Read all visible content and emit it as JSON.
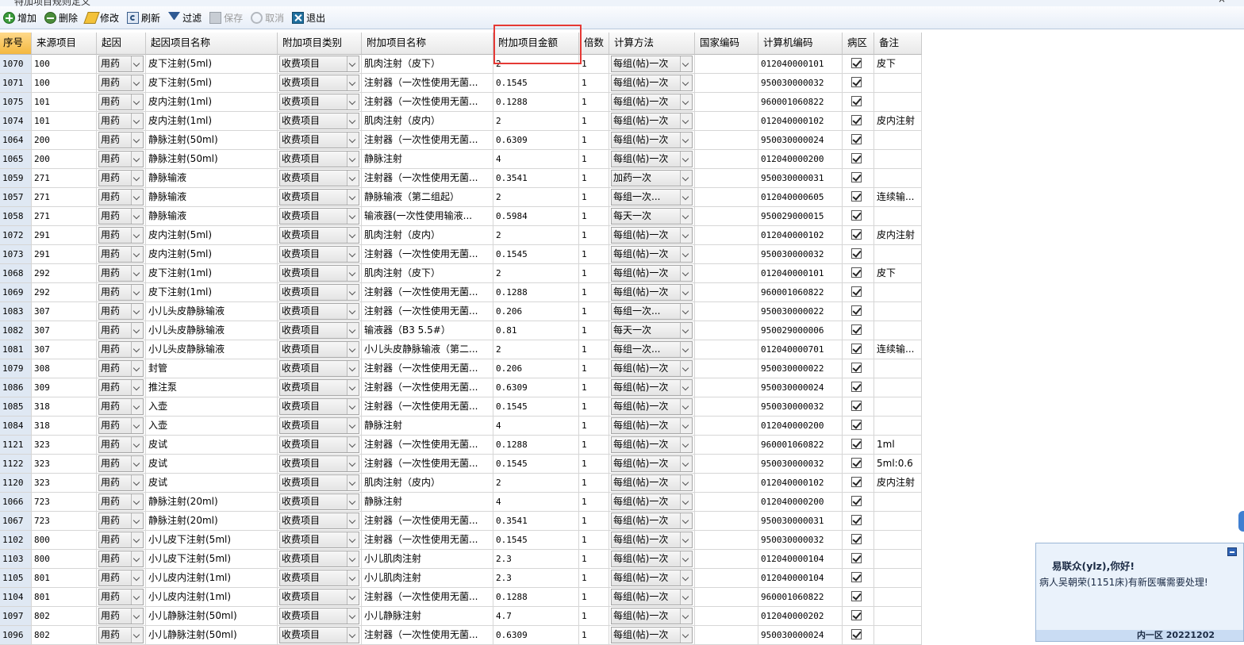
{
  "window": {
    "title": "特加项目规则定义",
    "minimize": "–",
    "close": "×"
  },
  "toolbar": [
    {
      "label": "增加",
      "icon": "add-icon",
      "enabled": true
    },
    {
      "label": "删除",
      "icon": "delete-icon",
      "enabled": true
    },
    {
      "label": "修改",
      "icon": "edit-icon",
      "enabled": true
    },
    {
      "label": "刷新",
      "icon": "refresh-icon",
      "enabled": true
    },
    {
      "label": "过滤",
      "icon": "filter-icon",
      "enabled": true
    },
    {
      "label": "保存",
      "icon": "save-icon",
      "enabled": false
    },
    {
      "label": "取消",
      "icon": "cancel-icon",
      "enabled": false
    },
    {
      "label": "退出",
      "icon": "exit-icon",
      "enabled": true
    }
  ],
  "columns": [
    "序号",
    "来源项目",
    "起因",
    "起因项目名称",
    "附加项目类别",
    "附加项目名称",
    "附加项目金额",
    "倍数",
    "计算方法",
    "国家编码",
    "计算机编码",
    "病区",
    "备注"
  ],
  "rows": [
    [
      "1070",
      "100",
      "用药",
      "皮下注射(5ml)",
      "收费项目",
      "肌肉注射（皮下）",
      "2",
      "1",
      "每组(帖)一次",
      "",
      "012040000101",
      true,
      "皮下"
    ],
    [
      "1071",
      "100",
      "用药",
      "皮下注射(5ml)",
      "收费项目",
      "注射器（一次性使用无菌...",
      "0.1545",
      "1",
      "每组(帖)一次",
      "",
      "950030000032",
      true,
      ""
    ],
    [
      "1075",
      "101",
      "用药",
      "皮内注射(1ml)",
      "收费项目",
      "注射器（一次性使用无菌...",
      "0.1288",
      "1",
      "每组(帖)一次",
      "",
      "960001060822",
      true,
      ""
    ],
    [
      "1074",
      "101",
      "用药",
      "皮内注射(1ml)",
      "收费项目",
      "肌肉注射（皮内）",
      "2",
      "1",
      "每组(帖)一次",
      "",
      "012040000102",
      true,
      "皮内注射"
    ],
    [
      "1064",
      "200",
      "用药",
      "静脉注射(50ml)",
      "收费项目",
      "注射器（一次性使用无菌...",
      "0.6309",
      "1",
      "每组(帖)一次",
      "",
      "950030000024",
      true,
      ""
    ],
    [
      "1065",
      "200",
      "用药",
      "静脉注射(50ml)",
      "收费项目",
      "静脉注射",
      "4",
      "1",
      "每组(帖)一次",
      "",
      "012040000200",
      true,
      ""
    ],
    [
      "1059",
      "271",
      "用药",
      "静脉输液",
      "收费项目",
      "注射器（一次性使用无菌...",
      "0.3541",
      "1",
      "加药一次",
      "",
      "950030000031",
      true,
      ""
    ],
    [
      "1057",
      "271",
      "用药",
      "静脉输液",
      "收费项目",
      "静脉输液（第二组起）",
      "2",
      "1",
      "每组一次...",
      "",
      "012040000605",
      true,
      "连续输..."
    ],
    [
      "1058",
      "271",
      "用药",
      "静脉输液",
      "收费项目",
      "输液器(一次性使用输液...",
      "0.5984",
      "1",
      "每天一次",
      "",
      "950029000015",
      true,
      ""
    ],
    [
      "1072",
      "291",
      "用药",
      "皮内注射(5ml)",
      "收费项目",
      "肌肉注射（皮内）",
      "2",
      "1",
      "每组(帖)一次",
      "",
      "012040000102",
      true,
      "皮内注射"
    ],
    [
      "1073",
      "291",
      "用药",
      "皮内注射(5ml)",
      "收费项目",
      "注射器（一次性使用无菌...",
      "0.1545",
      "1",
      "每组(帖)一次",
      "",
      "950030000032",
      true,
      ""
    ],
    [
      "1068",
      "292",
      "用药",
      "皮下注射(1ml)",
      "收费项目",
      "肌肉注射（皮下）",
      "2",
      "1",
      "每组(帖)一次",
      "",
      "012040000101",
      true,
      "皮下"
    ],
    [
      "1069",
      "292",
      "用药",
      "皮下注射(1ml)",
      "收费项目",
      "注射器（一次性使用无菌...",
      "0.1288",
      "1",
      "每组(帖)一次",
      "",
      "960001060822",
      true,
      ""
    ],
    [
      "1083",
      "307",
      "用药",
      "小儿头皮静脉输液",
      "收费项目",
      "注射器（一次性使用无菌...",
      "0.206",
      "1",
      "每组一次...",
      "",
      "950030000022",
      true,
      ""
    ],
    [
      "1082",
      "307",
      "用药",
      "小儿头皮静脉输液",
      "收费项目",
      "输液器（B3 5.5#）",
      "0.81",
      "1",
      "每天一次",
      "",
      "950029000006",
      true,
      ""
    ],
    [
      "1081",
      "307",
      "用药",
      "小儿头皮静脉输液",
      "收费项目",
      "小儿头皮静脉输液（第二...",
      "2",
      "1",
      "每组一次...",
      "",
      "012040000701",
      true,
      "连续输..."
    ],
    [
      "1079",
      "308",
      "用药",
      "封管",
      "收费项目",
      "注射器（一次性使用无菌...",
      "0.206",
      "1",
      "每组(帖)一次",
      "",
      "950030000022",
      true,
      ""
    ],
    [
      "1086",
      "309",
      "用药",
      "推注泵",
      "收费项目",
      "注射器（一次性使用无菌...",
      "0.6309",
      "1",
      "每组(帖)一次",
      "",
      "950030000024",
      true,
      ""
    ],
    [
      "1085",
      "318",
      "用药",
      "入壶",
      "收费项目",
      "注射器（一次性使用无菌...",
      "0.1545",
      "1",
      "每组(帖)一次",
      "",
      "950030000032",
      true,
      ""
    ],
    [
      "1084",
      "318",
      "用药",
      "入壶",
      "收费项目",
      "静脉注射",
      "4",
      "1",
      "每组(帖)一次",
      "",
      "012040000200",
      true,
      ""
    ],
    [
      "1121",
      "323",
      "用药",
      "皮试",
      "收费项目",
      "注射器（一次性使用无菌...",
      "0.1288",
      "1",
      "每组(帖)一次",
      "",
      "960001060822",
      true,
      "1ml"
    ],
    [
      "1122",
      "323",
      "用药",
      "皮试",
      "收费项目",
      "注射器（一次性使用无菌...",
      "0.1545",
      "1",
      "每组(帖)一次",
      "",
      "950030000032",
      true,
      "5ml:0.6"
    ],
    [
      "1120",
      "323",
      "用药",
      "皮试",
      "收费项目",
      "肌肉注射（皮内）",
      "2",
      "1",
      "每组(帖)一次",
      "",
      "012040000102",
      true,
      "皮内注射"
    ],
    [
      "1066",
      "723",
      "用药",
      "静脉注射(20ml)",
      "收费项目",
      "静脉注射",
      "4",
      "1",
      "每组(帖)一次",
      "",
      "012040000200",
      true,
      ""
    ],
    [
      "1067",
      "723",
      "用药",
      "静脉注射(20ml)",
      "收费项目",
      "注射器（一次性使用无菌...",
      "0.3541",
      "1",
      "每组(帖)一次",
      "",
      "950030000031",
      true,
      ""
    ],
    [
      "1102",
      "800",
      "用药",
      "小儿皮下注射(5ml)",
      "收费项目",
      "注射器（一次性使用无菌...",
      "0.1545",
      "1",
      "每组(帖)一次",
      "",
      "950030000032",
      true,
      ""
    ],
    [
      "1103",
      "800",
      "用药",
      "小儿皮下注射(5ml)",
      "收费项目",
      "小儿肌肉注射",
      "2.3",
      "1",
      "每组(帖)一次",
      "",
      "012040000104",
      true,
      ""
    ],
    [
      "1105",
      "801",
      "用药",
      "小儿皮内注射(1ml)",
      "收费项目",
      "小儿肌肉注射",
      "2.3",
      "1",
      "每组(帖)一次",
      "",
      "012040000104",
      true,
      ""
    ],
    [
      "1104",
      "801",
      "用药",
      "小儿皮内注射(1ml)",
      "收费项目",
      "注射器（一次性使用无菌...",
      "0.1288",
      "1",
      "每组(帖)一次",
      "",
      "960001060822",
      true,
      ""
    ],
    [
      "1097",
      "802",
      "用药",
      "小儿静脉注射(50ml)",
      "收费项目",
      "小儿静脉注射",
      "4.7",
      "1",
      "每组(帖)一次",
      "",
      "012040000202",
      true,
      ""
    ],
    [
      "1096",
      "802",
      "用药",
      "小儿静脉注射(50ml)",
      "收费项目",
      "注射器（一次性使用无菌...",
      "0.6309",
      "1",
      "每组(帖)一次",
      "",
      "950030000024",
      true,
      ""
    ]
  ],
  "notification": {
    "greeting": "易联众(ylz),你好!",
    "message": "病人吴朝荣(1151床)有新医嘱需要处理!",
    "footer": "内一区 20221202"
  },
  "colors": {
    "highlight_box": "#e53935",
    "selected_header": "#f3b840"
  }
}
